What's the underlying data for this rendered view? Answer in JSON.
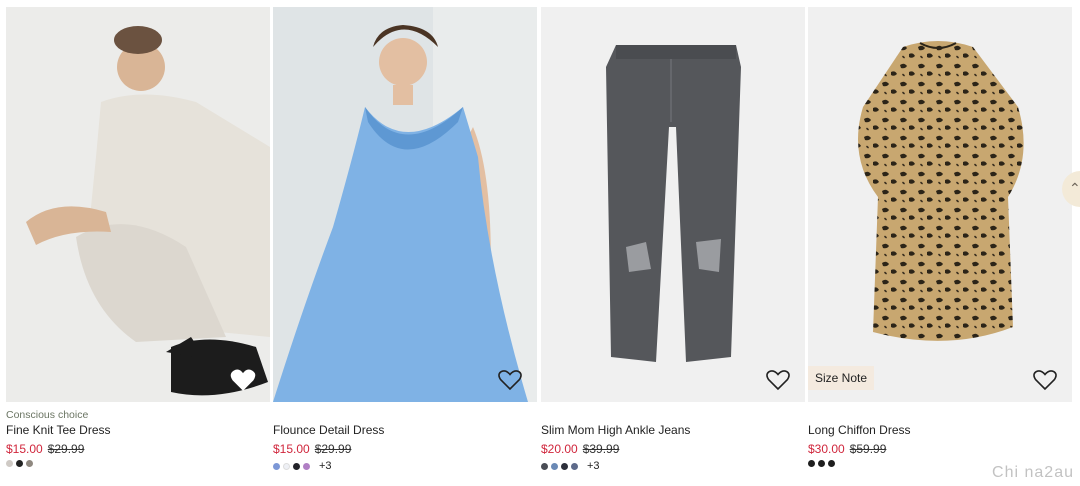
{
  "products": [
    {
      "tag": "Conscious choice",
      "name": "Fine Knit Tee Dress",
      "sale_price": "$15.00",
      "original_price": "$29.99",
      "swatches": [
        "#cfcac5",
        "#222222",
        "#8f8880"
      ],
      "more": "",
      "badge": "",
      "favorite_icon": "heart-outline-icon"
    },
    {
      "tag": "",
      "name": "Flounce Detail Dress",
      "sale_price": "$15.00",
      "original_price": "$29.99",
      "swatches": [
        "#7c97d6",
        "#eef0f5",
        "#23242a",
        "#b07fc4"
      ],
      "more": "+3",
      "badge": "",
      "favorite_icon": "heart-outline-icon"
    },
    {
      "tag": "",
      "name": "Slim Mom High Ankle Jeans",
      "sale_price": "$20.00",
      "original_price": "$39.99",
      "swatches": [
        "#4a4d55",
        "#6a89b5",
        "#2c2f3a",
        "#5d6a8a"
      ],
      "more": "+3",
      "badge": "",
      "favorite_icon": "heart-outline-icon"
    },
    {
      "tag": "",
      "name": "Long Chiffon Dress",
      "sale_price": "$30.00",
      "original_price": "$59.99",
      "swatches": [
        "#1e1e1e",
        "#1e1e1e",
        "#1e1e1e"
      ],
      "more": "",
      "badge": "Size Note",
      "favorite_icon": "heart-outline-icon"
    }
  ],
  "colors": {
    "sale": "#d0263c",
    "image_bg": "#f0f0f0",
    "eco_tag": "#6b7563"
  },
  "scroll_icon": "chevron-up-icon",
  "watermark": "Chi na2au"
}
